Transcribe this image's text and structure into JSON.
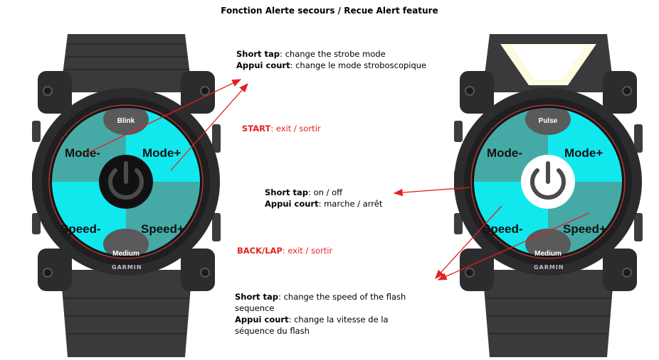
{
  "title": "Fonction Alerte secours / Recue Alert feature",
  "notes": {
    "top": {
      "line1_bold": "Short tap",
      "line1_rest": ": change the strobe mode",
      "line2_bold": "Appui court",
      "line2_rest": ": change le mode stroboscopique"
    },
    "start": {
      "bold": "START",
      "rest": ": exit / sortir"
    },
    "middle": {
      "line1_bold": "Short tap",
      "line1_rest": ": on / off",
      "line2_bold": "Appui court",
      "line2_rest": ": marche / arrêt"
    },
    "back": {
      "bold": "BACK/LAP",
      "rest": ": exit / sortir"
    },
    "bottom": {
      "line1_bold": "Short tap",
      "line1_rest": ": change the speed of the flash",
      "line2": "sequence",
      "line3_bold": "Appui court",
      "line3_rest": ": change la vitesse de la",
      "line4": "séquence du flash"
    }
  },
  "left_watch": {
    "top_pill": "Blink",
    "bottom_pill": "Medium",
    "mode_minus": "Mode-",
    "mode_plus": "Mode+",
    "speed_minus": "Speed-",
    "speed_plus": "Speed+",
    "brand": "GARMIN",
    "power_state": "off"
  },
  "right_watch": {
    "top_pill": "Pulse",
    "bottom_pill": "Medium",
    "mode_minus": "Mode-",
    "mode_plus": "Mode+",
    "speed_minus": "Speed-",
    "speed_plus": "Speed+",
    "brand": "GARMIN",
    "power_state": "on"
  },
  "colors": {
    "cyan": "#11e8ee",
    "teal": "#45aaa6",
    "pill": "#5a5a5a",
    "arrow": "#e52020",
    "bezel": "#2c2c2e",
    "strap": "#3a3a3c"
  }
}
